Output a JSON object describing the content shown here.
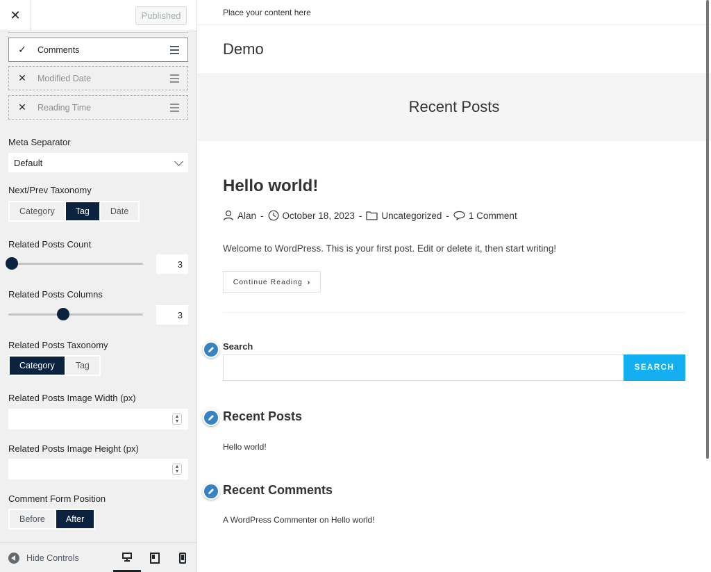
{
  "sidebar": {
    "close_glyph": "✕",
    "published_label": "Published",
    "meta_items": [
      {
        "label": "Comments",
        "state": "check",
        "glyph": "✓"
      },
      {
        "label": "Modified Date",
        "state": "x",
        "glyph": "✕"
      },
      {
        "label": "Reading Time",
        "state": "x",
        "glyph": "✕"
      }
    ],
    "meta_separator": {
      "label": "Meta Separator",
      "value": "Default"
    },
    "next_prev_taxonomy": {
      "label": "Next/Prev Taxonomy",
      "options": [
        "Category",
        "Tag",
        "Date"
      ],
      "selected": "Tag"
    },
    "related_posts_count": {
      "label": "Related Posts Count",
      "value": "3",
      "fraction": 0.0
    },
    "related_posts_columns": {
      "label": "Related Posts Columns",
      "value": "3",
      "fraction": 0.4
    },
    "related_posts_taxonomy": {
      "label": "Related Posts Taxonomy",
      "options": [
        "Category",
        "Tag"
      ],
      "selected": "Category"
    },
    "image_width": {
      "label": "Related Posts Image Width (px)",
      "value": ""
    },
    "image_height": {
      "label": "Related Posts Image Height (px)",
      "value": ""
    },
    "comment_form_position": {
      "label": "Comment Form Position",
      "options": [
        "Before",
        "After"
      ],
      "selected": "After"
    },
    "footer": {
      "hide_controls": "Hide Controls",
      "devices": [
        "desktop-icon",
        "tablet-icon",
        "mobile-icon"
      ],
      "active_device": "desktop"
    }
  },
  "preview": {
    "topbar_text": "Place your content here",
    "site_title": "Demo",
    "page_header_title": "Recent Posts",
    "post": {
      "title": "Hello world!",
      "author": "Alan",
      "date": "October 18, 2023",
      "category": "Uncategorized",
      "comments": "1 Comment",
      "separator": "-",
      "excerpt": "Welcome to WordPress. This is your first post. Edit or delete it, then start writing!",
      "continue_label": "Continue Reading",
      "continue_arrow": "›"
    },
    "search_widget": {
      "title": "Search",
      "button_label": "SEARCH",
      "value": ""
    },
    "recent_posts_widget": {
      "title": "Recent Posts",
      "items": [
        "Hello world!"
      ]
    },
    "recent_comments_widget": {
      "title": "Recent Comments",
      "author": "A WordPress Commenter",
      "connector": "on",
      "post": "Hello world!"
    }
  },
  "colors": {
    "accent_navy": "#0c2340",
    "search_blue": "#13aff0",
    "edit_badge_blue": "#3582c4"
  }
}
